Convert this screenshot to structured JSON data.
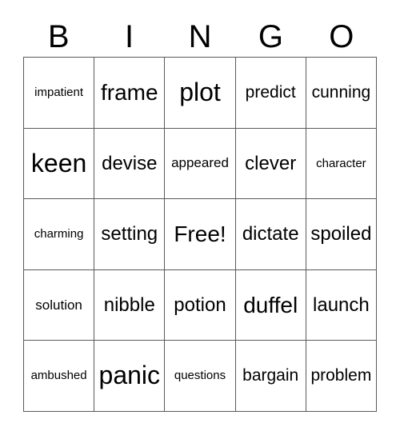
{
  "header": {
    "letters": [
      "B",
      "I",
      "N",
      "G",
      "O"
    ]
  },
  "grid": {
    "rows": [
      [
        {
          "text": "impatient",
          "size": "xs"
        },
        {
          "text": "frame",
          "size": "xl"
        },
        {
          "text": "plot",
          "size": "xxl"
        },
        {
          "text": "predict",
          "size": "m"
        },
        {
          "text": "cunning",
          "size": "m"
        }
      ],
      [
        {
          "text": "keen",
          "size": "xxl"
        },
        {
          "text": "devise",
          "size": "l"
        },
        {
          "text": "appeared",
          "size": "s"
        },
        {
          "text": "clever",
          "size": "l"
        },
        {
          "text": "character",
          "size": "xs"
        }
      ],
      [
        {
          "text": "charming",
          "size": "xs"
        },
        {
          "text": "setting",
          "size": "l"
        },
        {
          "text": "Free!",
          "size": "xl"
        },
        {
          "text": "dictate",
          "size": "l"
        },
        {
          "text": "spoiled",
          "size": "l"
        }
      ],
      [
        {
          "text": "solution",
          "size": "s"
        },
        {
          "text": "nibble",
          "size": "l"
        },
        {
          "text": "potion",
          "size": "l"
        },
        {
          "text": "duffel",
          "size": "xl"
        },
        {
          "text": "launch",
          "size": "l"
        }
      ],
      [
        {
          "text": "ambushed",
          "size": "xs"
        },
        {
          "text": "panic",
          "size": "xxl"
        },
        {
          "text": "questions",
          "size": "xs"
        },
        {
          "text": "bargain",
          "size": "m"
        },
        {
          "text": "problem",
          "size": "m"
        }
      ]
    ],
    "free_space": {
      "row": 2,
      "col": 2,
      "label": "Free!"
    }
  },
  "colors": {
    "background": "#ffffff",
    "text": "#000000",
    "border": "#5a5a5a"
  }
}
